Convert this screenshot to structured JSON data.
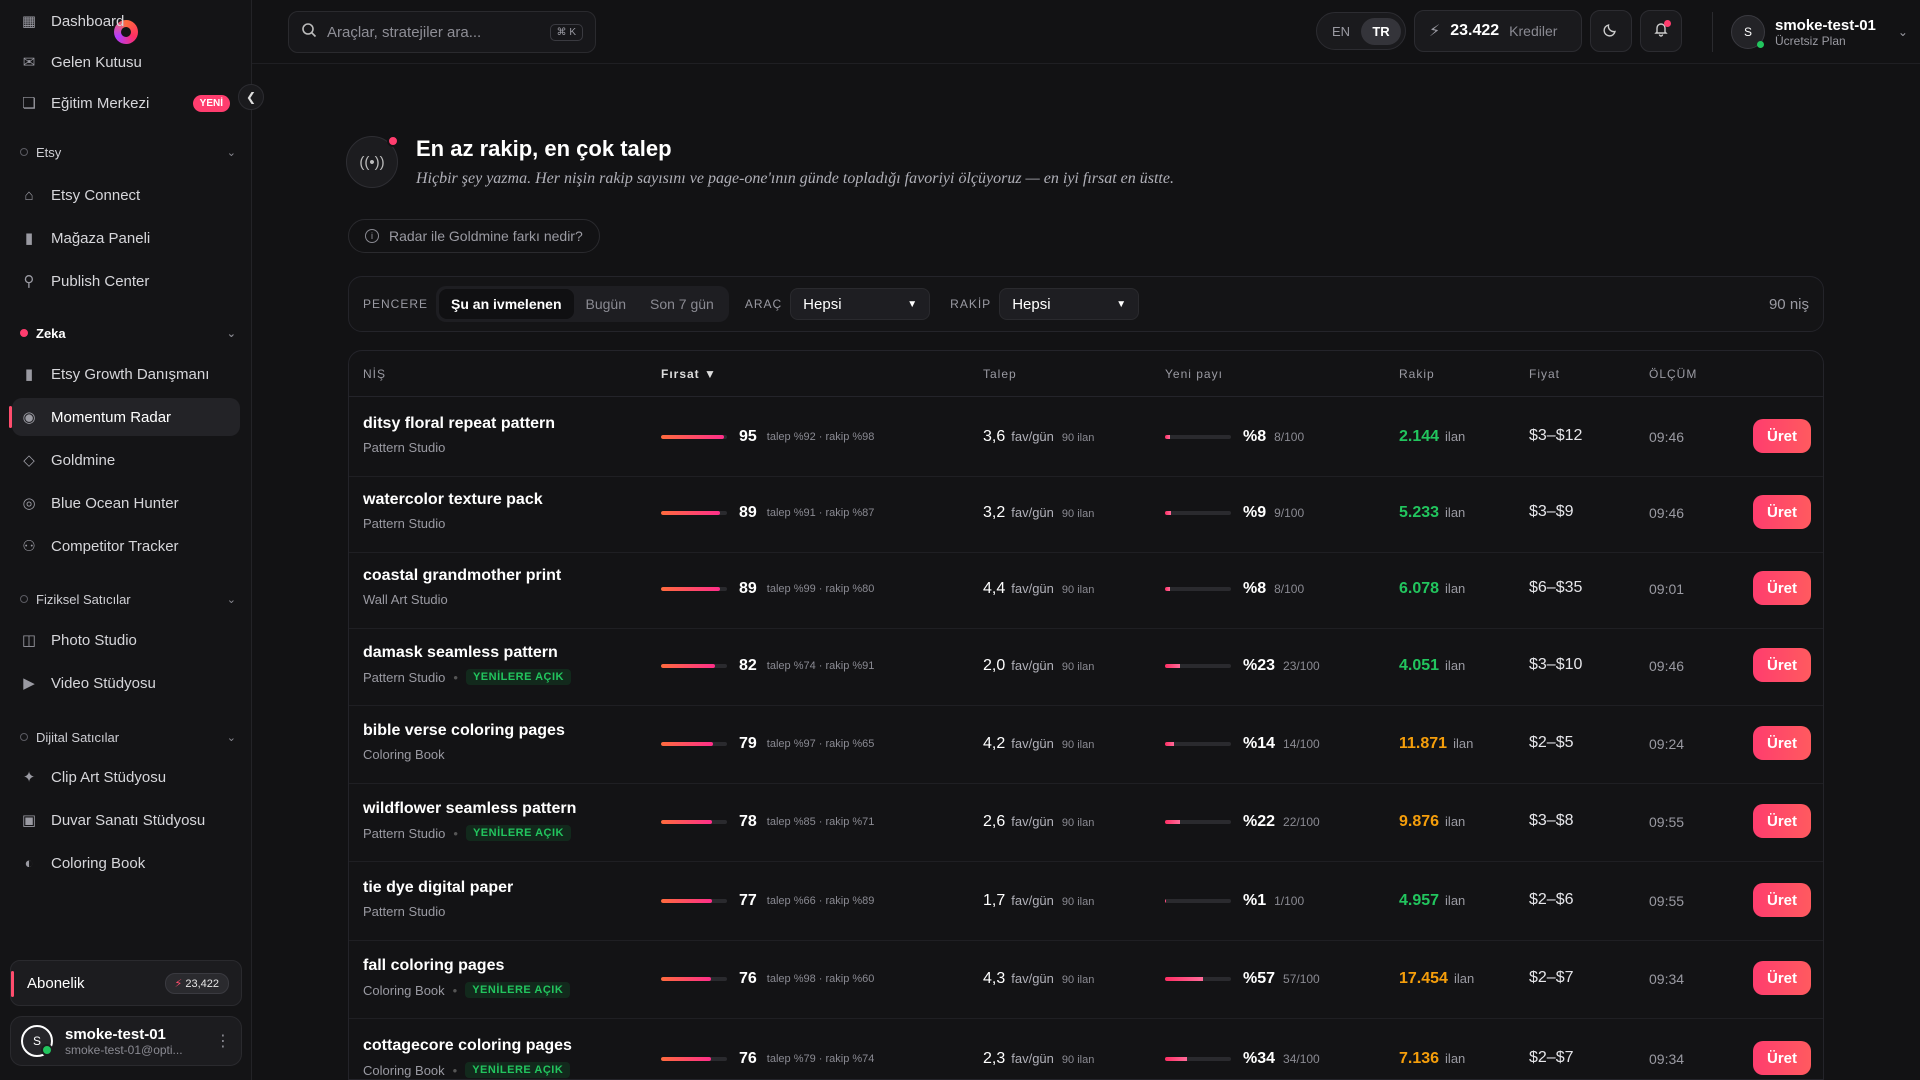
{
  "sidebar": {
    "items": [
      {
        "label": "Dashboard",
        "icon": "grid-icon"
      },
      {
        "label": "Gelen Kutusu",
        "icon": "inbox-icon"
      },
      {
        "label": "Eğitim Merkezi",
        "icon": "book-icon",
        "badge": "YENİ"
      }
    ],
    "sections": {
      "etsy": {
        "label": "Etsy",
        "items": [
          "Etsy Connect",
          "Mağaza Paneli",
          "Publish Center"
        ]
      },
      "zeka": {
        "label": "Zeka",
        "items": [
          "Etsy Growth Danışmanı",
          "Momentum Radar",
          "Goldmine",
          "Blue Ocean Hunter",
          "Competitor Tracker"
        ]
      },
      "fiziksel": {
        "label": "Fiziksel Satıcılar",
        "items": [
          "Photo Studio",
          "Video Stüdyosu"
        ]
      },
      "dijital": {
        "label": "Dijital Satıcılar",
        "items": [
          "Clip Art Stüdyosu",
          "Duvar Sanatı Stüdyosu",
          "Coloring Book"
        ]
      }
    },
    "active_item": "Momentum Radar",
    "subscription": {
      "label": "Abonelik",
      "credits": "23,422"
    },
    "user": {
      "initial": "S",
      "name": "smoke-test-01",
      "email": "smoke-test-01@opti..."
    }
  },
  "topbar": {
    "search_placeholder": "Araçlar, stratejiler ara...",
    "search_shortcut": "⌘ K",
    "lang": [
      "EN",
      "TR"
    ],
    "lang_active": "TR",
    "credits_value": "23.422",
    "credits_label": "Krediler",
    "user_initial": "S",
    "user_name": "smoke-test-01",
    "user_plan": "Ücretsiz Plan"
  },
  "hero": {
    "title": "En az rakip, en çok talep",
    "subtitle": "Hiçbir şey yazma. Her nişin rakip sayısını ve page-one'ının günde topladığı favoriyi ölçüyoruz — en iyi fırsat en üstte.",
    "info": "Radar ile Goldmine farkı nedir?"
  },
  "filters": {
    "window_label": "PENCERE",
    "window_options": [
      "Şu an ivmelenen",
      "Bugün",
      "Son 7 gün"
    ],
    "window_active": 0,
    "tool_label": "ARAÇ",
    "tool_value": "Hepsi",
    "competitor_label": "RAKİP",
    "competitor_value": "Hepsi",
    "count": "90 niş"
  },
  "table": {
    "columns": [
      "NİŞ",
      "Fırsat ▼",
      "Talep",
      "Yeni payı",
      "Rakip",
      "Fiyat",
      "ÖLÇÜM"
    ],
    "action_label": "Üret",
    "fav_unit": "fav/gün",
    "listing_unit": "ilan",
    "rows": [
      {
        "name": "ditsy floral repeat pattern",
        "tool": "Pattern Studio",
        "tag": "",
        "score": 95,
        "score_detail": "talep %92 · rakip %98",
        "demand": "3,6",
        "listings": "90 ilan",
        "new_share": "%8",
        "new_detail": "8/100",
        "new_frac": 0.08,
        "competitors": "2.144",
        "comp_color": "green",
        "price": "$3–$12",
        "time": "09:46"
      },
      {
        "name": "watercolor texture pack",
        "tool": "Pattern Studio",
        "tag": "",
        "score": 89,
        "score_detail": "talep %91 · rakip %87",
        "demand": "3,2",
        "listings": "90 ilan",
        "new_share": "%9",
        "new_detail": "9/100",
        "new_frac": 0.09,
        "competitors": "5.233",
        "comp_color": "green",
        "price": "$3–$9",
        "time": "09:46"
      },
      {
        "name": "coastal grandmother print",
        "tool": "Wall Art Studio",
        "tag": "",
        "score": 89,
        "score_detail": "talep %99 · rakip %80",
        "demand": "4,4",
        "listings": "90 ilan",
        "new_share": "%8",
        "new_detail": "8/100",
        "new_frac": 0.08,
        "competitors": "6.078",
        "comp_color": "green",
        "price": "$6–$35",
        "time": "09:01"
      },
      {
        "name": "damask seamless pattern",
        "tool": "Pattern Studio",
        "tag": "YENİLERE AÇIK",
        "score": 82,
        "score_detail": "talep %74 · rakip %91",
        "demand": "2,0",
        "listings": "90 ilan",
        "new_share": "%23",
        "new_detail": "23/100",
        "new_frac": 0.23,
        "competitors": "4.051",
        "comp_color": "green",
        "price": "$3–$10",
        "time": "09:46"
      },
      {
        "name": "bible verse coloring pages",
        "tool": "Coloring Book",
        "tag": "",
        "score": 79,
        "score_detail": "talep %97 · rakip %65",
        "demand": "4,2",
        "listings": "90 ilan",
        "new_share": "%14",
        "new_detail": "14/100",
        "new_frac": 0.14,
        "competitors": "11.871",
        "comp_color": "orange",
        "price": "$2–$5",
        "time": "09:24"
      },
      {
        "name": "wildflower seamless pattern",
        "tool": "Pattern Studio",
        "tag": "YENİLERE AÇIK",
        "score": 78,
        "score_detail": "talep %85 · rakip %71",
        "demand": "2,6",
        "listings": "90 ilan",
        "new_share": "%22",
        "new_detail": "22/100",
        "new_frac": 0.22,
        "competitors": "9.876",
        "comp_color": "orange",
        "price": "$3–$8",
        "time": "09:55"
      },
      {
        "name": "tie dye digital paper",
        "tool": "Pattern Studio",
        "tag": "",
        "score": 77,
        "score_detail": "talep %66 · rakip %89",
        "demand": "1,7",
        "listings": "90 ilan",
        "new_share": "%1",
        "new_detail": "1/100",
        "new_frac": 0.01,
        "competitors": "4.957",
        "comp_color": "green",
        "price": "$2–$6",
        "time": "09:55"
      },
      {
        "name": "fall coloring pages",
        "tool": "Coloring Book",
        "tag": "YENİLERE AÇIK",
        "score": 76,
        "score_detail": "talep %98 · rakip %60",
        "demand": "4,3",
        "listings": "90 ilan",
        "new_share": "%57",
        "new_detail": "57/100",
        "new_frac": 0.57,
        "competitors": "17.454",
        "comp_color": "orange",
        "price": "$2–$7",
        "time": "09:34"
      },
      {
        "name": "cottagecore coloring pages",
        "tool": "Coloring Book",
        "tag": "YENİLERE AÇIK",
        "score": 76,
        "score_detail": "talep %79 · rakip %74",
        "demand": "2,3",
        "listings": "90 ilan",
        "new_share": "%34",
        "new_detail": "34/100",
        "new_frac": 0.34,
        "competitors": "7.136",
        "comp_color": "orange",
        "price": "$2–$7",
        "time": "09:34"
      }
    ]
  }
}
